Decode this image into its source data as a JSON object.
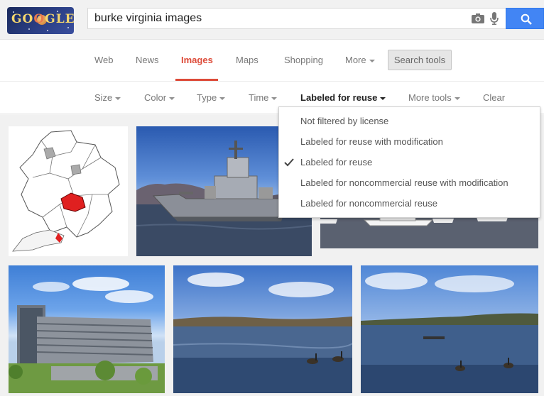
{
  "search": {
    "query": "burke virginia images"
  },
  "tabs": [
    {
      "label": "Web"
    },
    {
      "label": "News"
    },
    {
      "label": "Images"
    },
    {
      "label": "Maps"
    },
    {
      "label": "Shopping"
    },
    {
      "label": "More"
    }
  ],
  "active_tab": "Images",
  "search_tools_label": "Search tools",
  "filters": [
    {
      "label": "Size"
    },
    {
      "label": "Color"
    },
    {
      "label": "Type"
    },
    {
      "label": "Time"
    },
    {
      "label": "Labeled for reuse"
    },
    {
      "label": "More tools"
    },
    {
      "label": "Clear"
    }
  ],
  "license_menu": {
    "items": [
      {
        "label": "Not filtered by license",
        "checked": false
      },
      {
        "label": "Labeled for reuse with modification",
        "checked": false
      },
      {
        "label": "Labeled for reuse",
        "checked": true
      },
      {
        "label": "Labeled for noncommercial reuse with modification",
        "checked": false
      },
      {
        "label": "Labeled for noncommercial reuse",
        "checked": false
      }
    ]
  },
  "colors": {
    "accent_red": "#dd4b39",
    "search_blue": "#4285f4"
  },
  "icons": [
    "camera-icon",
    "microphone-icon",
    "magnifier-icon",
    "checkmark-icon"
  ]
}
